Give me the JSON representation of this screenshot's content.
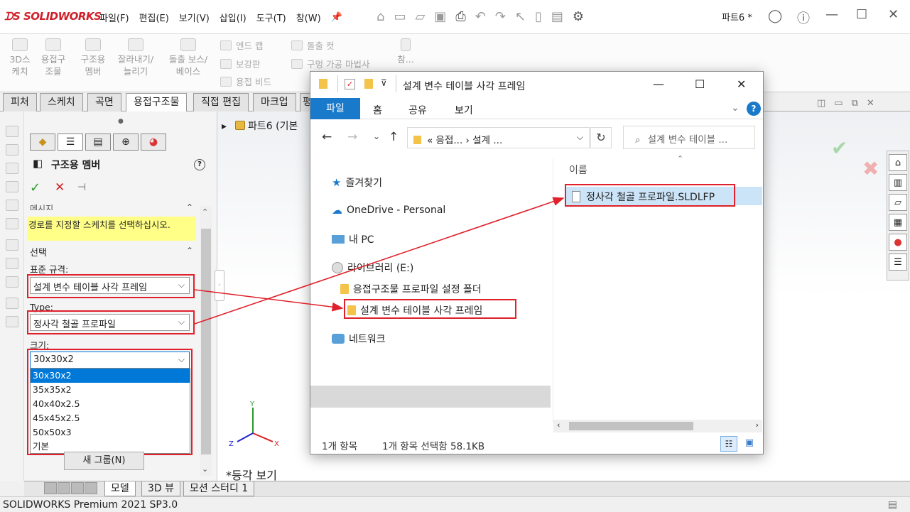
{
  "app": {
    "logo": "SOLIDWORKS",
    "menus": [
      "파일(F)",
      "편집(E)",
      "보기(V)",
      "삽입(I)",
      "도구(T)",
      "창(W)"
    ],
    "part_title": "파트6 *"
  },
  "ribbon": {
    "big_items": [
      {
        "l1": "3D스",
        "l2": "케치"
      },
      {
        "l1": "용접구",
        "l2": "조물"
      },
      {
        "l1": "구조용",
        "l2": "멤버"
      },
      {
        "l1": "잘라내기/",
        "l2": "늘리기"
      },
      {
        "l1": "돌출 보스/",
        "l2": "베이스"
      }
    ],
    "small_items": [
      "엔드 캡",
      "보강판",
      "용접 비드",
      "돌출 컷",
      "구멍 가공 마법사",
      "참..."
    ]
  },
  "tabs": [
    "피처",
    "스케치",
    "곡면",
    "용접구조물",
    "직접 편집",
    "마크업",
    "평"
  ],
  "pm": {
    "title": "구조용 멤버",
    "message_header": "메시지",
    "message": "경로를 지정할 스케치를 선택하십시오.",
    "selection_header": "선택",
    "standard_label": "표준 규격:",
    "standard_value": "설계 변수 테이블 사각 프레임",
    "type_label": "Type:",
    "type_value": "정사각 철골 프로파일",
    "size_label": "크기:",
    "size_value": "30x30x2",
    "size_options": [
      "30x30x2",
      "35x35x2",
      "40x40x2.5",
      "45x45x2.5",
      "50x50x3",
      "기본"
    ],
    "new_group": "새 그룹(N)"
  },
  "tree": {
    "root": "파트6  (기본"
  },
  "view_label": "*등각 보기",
  "bottom_tabs": [
    "모델",
    "3D 뷰",
    "모션 스터디 1"
  ],
  "status": "SOLIDWORKS Premium 2021 SP3.0",
  "explorer": {
    "title": "설계 변수 테이블 사각 프레임",
    "ribbon_tabs": [
      "파일",
      "홈",
      "공유",
      "보기"
    ],
    "address": "«  응접...  ›   설계 ...",
    "search_placeholder": "설계 변수 테이블 ...",
    "nav": {
      "quick": "즐겨찾기",
      "onedrive": "OneDrive - Personal",
      "pc": "내 PC",
      "library": "라이브러리 (E:)",
      "folder1": "응접구조물 프로파일 설정 폴더",
      "folder2": "설계 변수 테이블 사각 프레임",
      "network": "네트워크"
    },
    "column_name": "이름",
    "file": "정사각 철골 프로파일.SLDLFP",
    "status_count": "1개 항목",
    "status_selected": "1개 항목 선택함 58.1KB"
  },
  "colors": {
    "annotation_red": "#e0202a",
    "accent_blue": "#1979ca",
    "selection": "#0078d7"
  }
}
